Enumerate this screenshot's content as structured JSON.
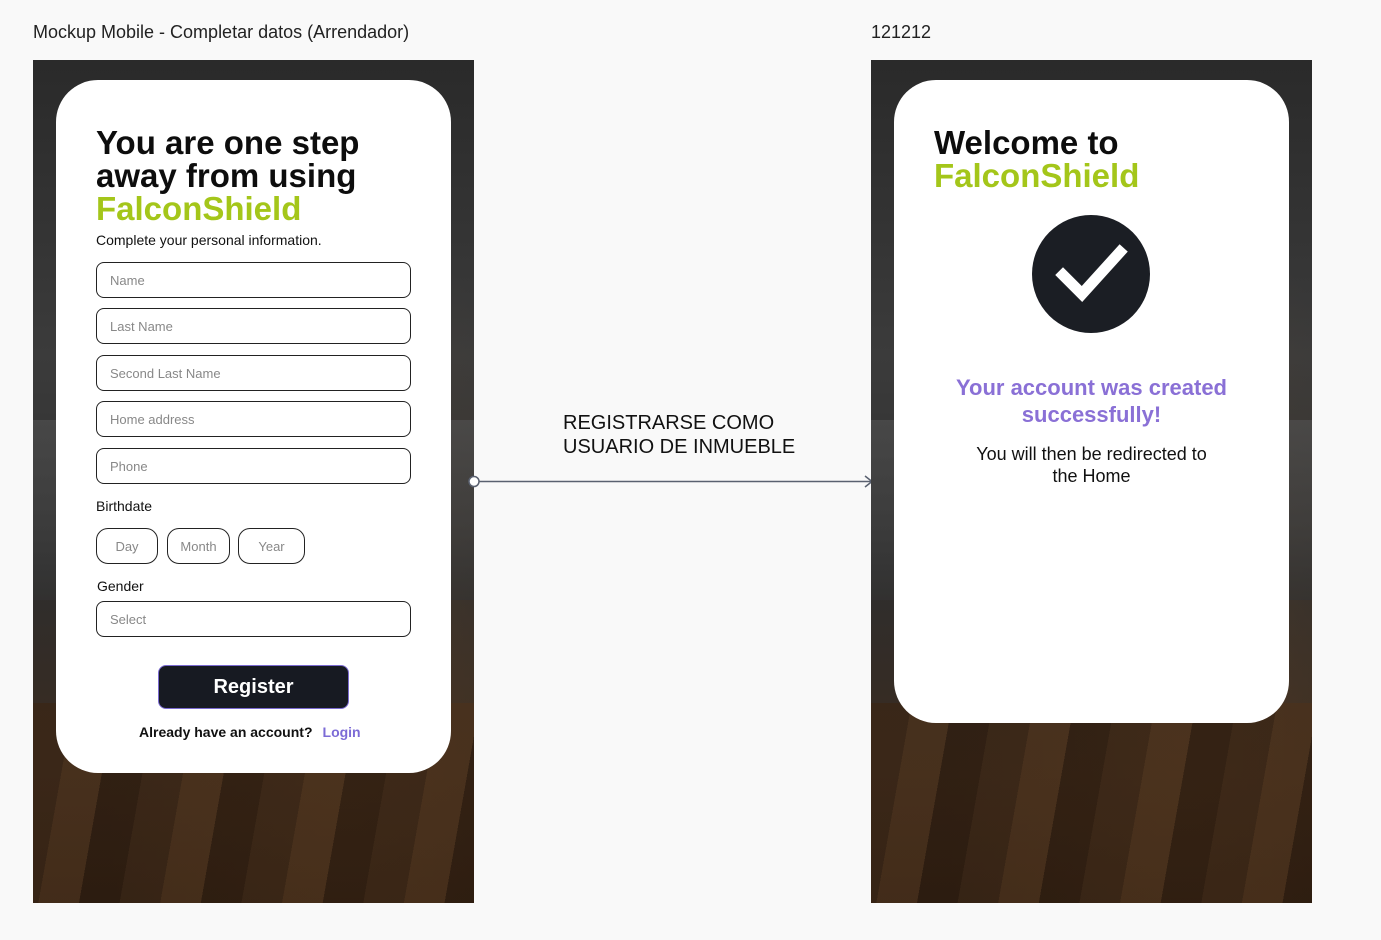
{
  "frames": {
    "left_label": "Mockup Mobile - Completar datos (Arrendador)",
    "right_label": "121212"
  },
  "register_screen": {
    "title_line1": "You are one step",
    "title_line2": "away from using",
    "brand": "FalconShield",
    "subtitle": "Complete your personal information.",
    "fields": {
      "name": "Name",
      "last_name": "Last Name",
      "second_last_name": "Second Last Name",
      "home_address": "Home address",
      "phone": "Phone"
    },
    "birthdate_label": "Birthdate",
    "birthdate": {
      "day": "Day",
      "month": "Month",
      "year": "Year"
    },
    "gender_label": "Gender",
    "gender_placeholder": "Select",
    "register_button": "Register",
    "already_text": "Already have an account?",
    "login_link": "Login"
  },
  "flow_arrow": {
    "label_line1": "REGISTRARSE COMO",
    "label_line2": "USUARIO DE INMUEBLE"
  },
  "welcome_screen": {
    "title": "Welcome to",
    "brand": "FalconShield",
    "success_line1": "Your account was created",
    "success_line2": "successfully!",
    "redirect_line1": "You will then be redirected to",
    "redirect_line2": "the Home"
  },
  "colors": {
    "brand_green": "#a4c61a",
    "accent_purple": "#8a70d6",
    "button_dark": "#171a22"
  }
}
